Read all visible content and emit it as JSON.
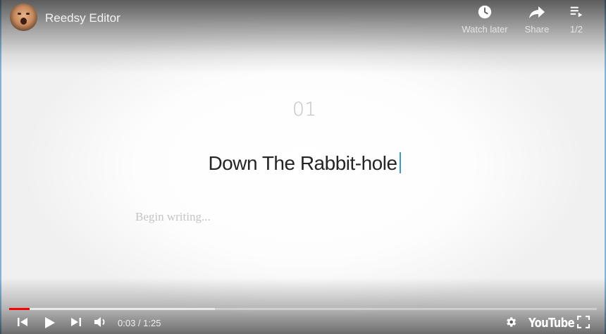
{
  "header": {
    "channel_title": "Reedsy Editor",
    "actions": [
      {
        "id": "watch-later",
        "label": "Watch later",
        "icon": "clock-icon"
      },
      {
        "id": "share",
        "label": "Share",
        "icon": "share-arrow-icon"
      },
      {
        "id": "playlist",
        "label": "1/2",
        "icon": "playlist-icon"
      }
    ]
  },
  "content": {
    "chapter_number": "01",
    "chapter_title": "Down The Rabbit-hole",
    "body_placeholder": "Begin writing..."
  },
  "controls": {
    "current_time": "0:03",
    "duration": "1:25",
    "time_display": "0:03 / 1:25",
    "played_fraction": 0.035,
    "loaded_fraction": 0.35,
    "logo_text": "YouTube",
    "icons": [
      "skip-previous-icon",
      "play-icon",
      "skip-next-icon",
      "volume-icon",
      "settings-gear-icon",
      "fullscreen-icon"
    ]
  },
  "colors": {
    "progress_played": "#ff0000",
    "cursor": "#3d9ad6",
    "frame_border": "#7fb4d8"
  }
}
